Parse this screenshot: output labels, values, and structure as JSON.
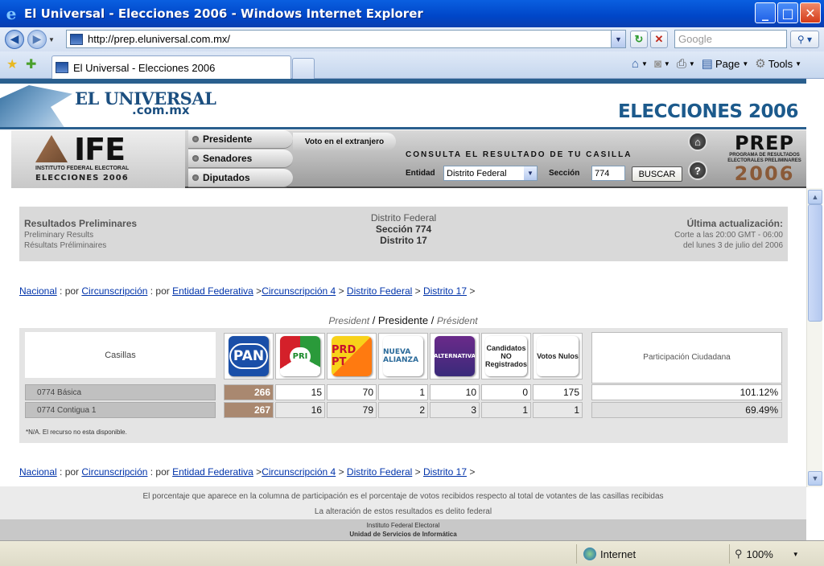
{
  "window": {
    "title": "El Universal - Elecciones 2006 - Windows Internet Explorer",
    "min": "_",
    "max": "□",
    "close": "✕"
  },
  "address": {
    "url": "http://prep.eluniversal.com.mx/",
    "search_placeholder": "Google"
  },
  "tab": {
    "label": "El Universal - Elecciones 2006"
  },
  "commands": {
    "page": "Page",
    "tools": "Tools"
  },
  "site": {
    "logo_line1": "EL UNIVERSAL",
    "logo_line2": ".com.mx",
    "section_title": "ELECCIONES 2006"
  },
  "ife": {
    "logo": "IFE",
    "logo_sub": "INSTITUTO FEDERAL ELECTORAL",
    "logo_sub2": "ELECCIONES 2006",
    "nav": [
      "Presidente",
      "Senadores",
      "Diputados"
    ],
    "voto_extranjero": "Voto en el extranjero",
    "consulta": "CONSULTA EL RESULTADO DE TU CASILLA",
    "entidad_label": "Entidad",
    "entidad_value": "Distrito Federal",
    "seccion_label": "Sección",
    "seccion_value": "774",
    "buscar": "BUSCAR",
    "help": "?",
    "prep_title": "PREP",
    "prep_sub": "PROGRAMA DE RESULTADOS ELECTORALES PRELIMINARES",
    "prep_year": "2006"
  },
  "results_header": {
    "left_title": "Resultados Preliminares",
    "left_en": "Preliminary Results",
    "left_fr": "Résultats Préliminaires",
    "mid_1": "Distrito Federal",
    "mid_2": "Sección 774",
    "mid_3": "Distrito 17",
    "right_title": "Última actualización:",
    "right_2": "Corte a las 20:00 GMT - 06:00",
    "right_3": "del lunes 3 de julio del 2006"
  },
  "breadcrumb": {
    "nacional": "Nacional",
    "por1": " : por ",
    "circ": "Circunscripción",
    "por2": " : por ",
    "entidad": "Entidad Federativa",
    "gt1": " >",
    "circ4": "Circunscripción 4",
    "gt2": " >",
    "df": "Distrito Federal",
    "gt3": " >",
    "d17": "Distrito 17",
    "gt4": " >"
  },
  "office_title": {
    "en": "President",
    "sep1": " / ",
    "es": "Presidente",
    "sep2": " / ",
    "fr": "Président"
  },
  "table": {
    "casillas_header": "Casillas",
    "parties": [
      "PAN",
      "PRI",
      "PRD PT",
      "NUEVA ALIANZA",
      "ALTERNATIVA"
    ],
    "cand_no_reg": "Candidatos NO Registrados",
    "votos_nulos": "Votos Nulos",
    "participacion": "Participación Ciudadana",
    "rows": [
      {
        "label": "0774 Básica",
        "values": [
          "266",
          "15",
          "70",
          "1",
          "10",
          "0",
          "175"
        ],
        "participacion": "101.12%"
      },
      {
        "label": "0774 Contigua 1",
        "values": [
          "267",
          "16",
          "79",
          "2",
          "3",
          "1",
          "1"
        ],
        "participacion": "69.49%"
      }
    ],
    "note": "*N/A. El recurso no esta disponible."
  },
  "footer": {
    "line1": "El porcentaje que aparece en la columna de participación es el porcentaje de votos recibidos respecto al total de votantes de las casillas recibidas",
    "line2": "La alteración de estos resultados es delito federal",
    "line3": "Instituto Federal Electoral",
    "line4": "Unidad de Servicios de Informática"
  },
  "status": {
    "zone": "Internet",
    "zoom": "100%"
  }
}
